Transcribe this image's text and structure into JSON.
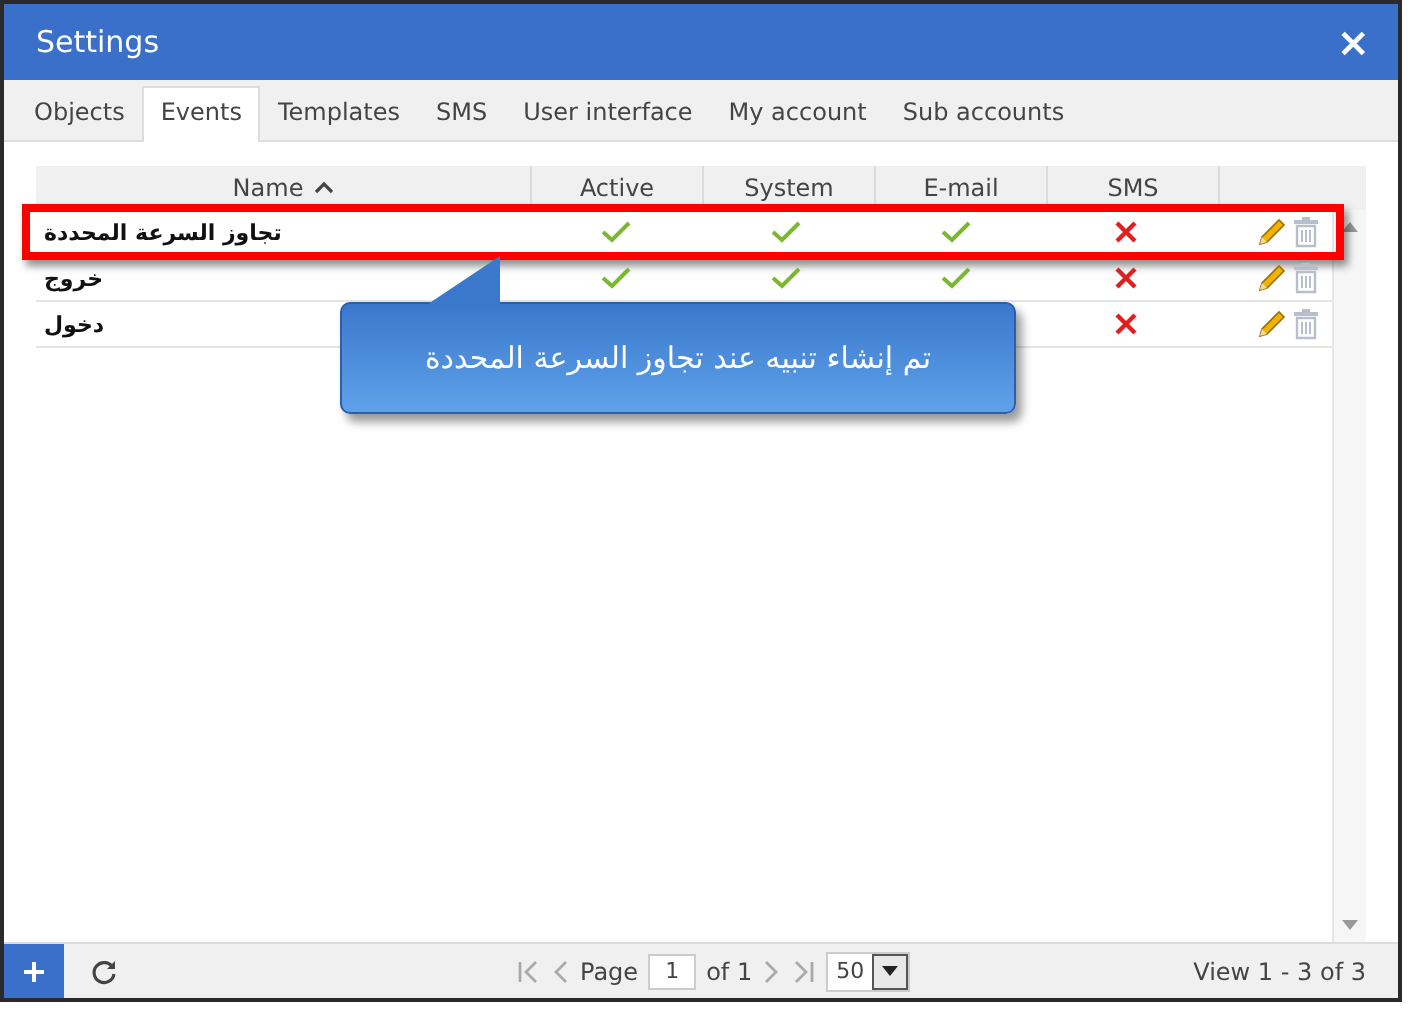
{
  "window": {
    "title": "Settings",
    "close": "×"
  },
  "tabs": [
    {
      "label": "Objects",
      "selected": false
    },
    {
      "label": "Events",
      "selected": true
    },
    {
      "label": "Templates",
      "selected": false
    },
    {
      "label": "SMS",
      "selected": false
    },
    {
      "label": "User interface",
      "selected": false
    },
    {
      "label": "My account",
      "selected": false
    },
    {
      "label": "Sub accounts",
      "selected": false
    }
  ],
  "table": {
    "columns": [
      "Name",
      "Active",
      "System",
      "E-mail",
      "SMS"
    ],
    "rows": [
      {
        "name": "تجاوز السرعة المحددة",
        "active": true,
        "system": true,
        "email": true,
        "sms": false,
        "highlighted": true
      },
      {
        "name": "خروج",
        "active": true,
        "system": true,
        "email": true,
        "sms": false,
        "highlighted": false
      },
      {
        "name": "دخول",
        "sms": false,
        "highlighted": false
      }
    ]
  },
  "callout": {
    "text": "تم إنشاء تنبيه عند تجاوز السرعة المحددة"
  },
  "pager": {
    "page_label": "Page",
    "page": "1",
    "of": "of 1",
    "per_page": "50",
    "view": "View 1 - 3 of 3"
  }
}
